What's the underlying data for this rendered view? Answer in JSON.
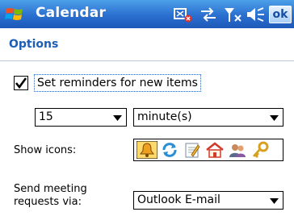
{
  "titlebar": {
    "app_title": "Calendar",
    "ok_label": "ok",
    "icons": [
      "start-windows-icon",
      "sync-icon",
      "connectivity-icon",
      "signal-icon",
      "volume-icon"
    ]
  },
  "options": {
    "section_title": "Options",
    "reminder_checkbox": {
      "checked": true,
      "label": "Set reminders for new items"
    },
    "reminder_amount": {
      "value": "15"
    },
    "reminder_unit": {
      "value": "minute(s)"
    },
    "show_icons": {
      "label": "Show icons:",
      "icons": [
        "reminder-bell-icon",
        "recurrence-icon",
        "notes-icon",
        "location-home-icon",
        "attendees-icon",
        "private-key-icon"
      ]
    },
    "meeting_requests": {
      "label_line1": "Send meeting",
      "label_line2": "requests via:",
      "value": "Outlook E-mail"
    }
  },
  "colors": {
    "titlebar": "#2a6fd0",
    "section_title": "#1c5fb8",
    "selection_highlight": "#ffd96b"
  }
}
